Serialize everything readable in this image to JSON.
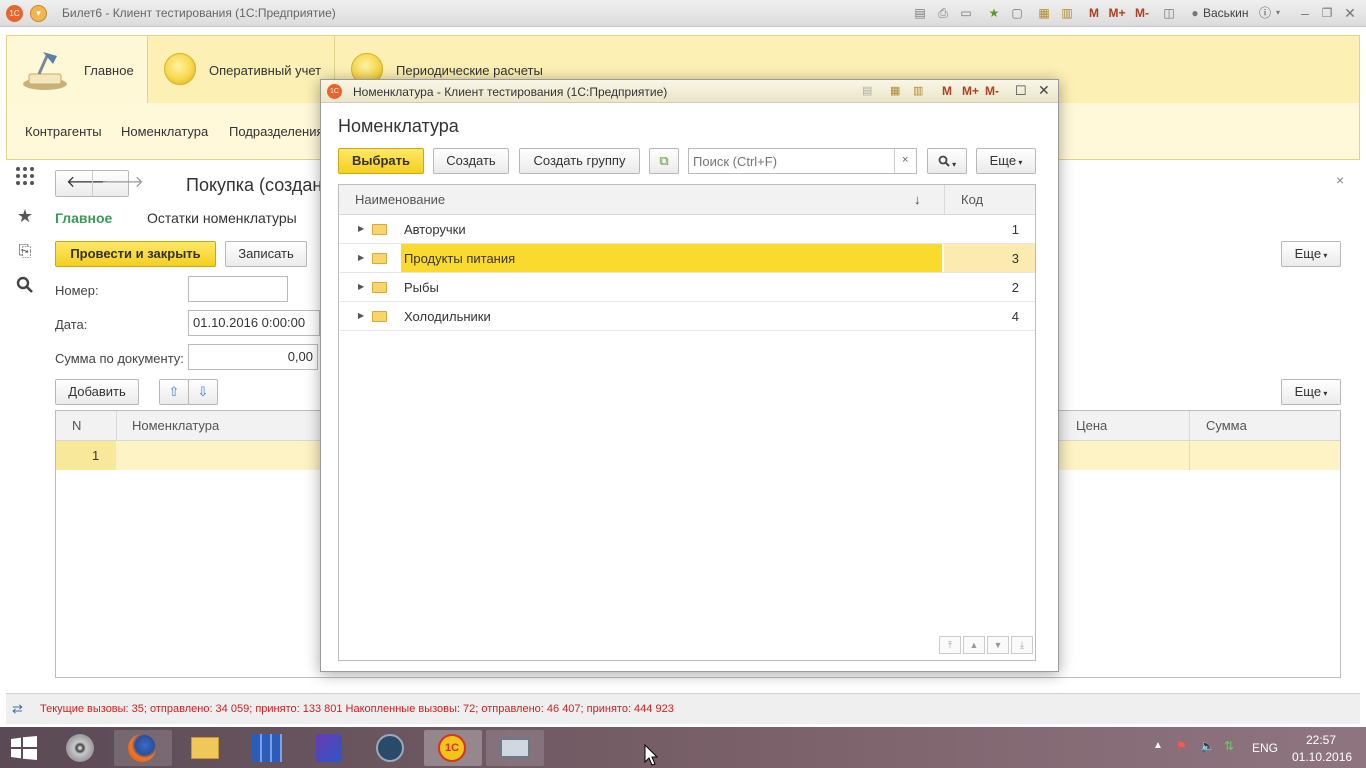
{
  "app": {
    "title": "Билет6  - Клиент тестирования (1С:Предприятие)",
    "user": "Васькин",
    "m_label": "M",
    "mplus_label": "M+",
    "mminus_label": "M-"
  },
  "sections": [
    {
      "label": "Главное"
    },
    {
      "label": "Оперативный учет"
    },
    {
      "label": "Периодические расчеты"
    }
  ],
  "nav": {
    "items": [
      {
        "label": "Контрагенты"
      },
      {
        "label": "Номенклатура"
      },
      {
        "label": "Подразделения"
      }
    ]
  },
  "form": {
    "title": "Покупка (создан",
    "tab_main": "Главное",
    "tab_remains": "Остатки номенклатуры",
    "post_close_label": "Провести и закрыть",
    "save_label": "Записать",
    "more_label": "Еще",
    "number_label": "Номер:",
    "number_value": "",
    "date_label": "Дата:",
    "date_value": "01.10.2016  0:00:00",
    "sum_label": "Сумма по документу:",
    "sum_value": "0,00",
    "add_label": "Добавить",
    "table": {
      "col_n": "N",
      "col_item": "Номенклатура",
      "col_price": "Цена",
      "col_sum": "Сумма",
      "rows": [
        {
          "n": "1"
        }
      ]
    }
  },
  "dialog": {
    "window_title": "Номенклатура  - Клиент тестирования (1С:Предприятие)",
    "heading": "Номенклатура",
    "select_label": "Выбрать",
    "create_label": "Создать",
    "create_group_label": "Создать группу",
    "search_placeholder": "Поиск (Ctrl+F)",
    "more_label": "Еще",
    "col_name": "Наименование",
    "col_code": "Код",
    "rows": [
      {
        "name": "Авторучки",
        "code": "1"
      },
      {
        "name": "Продукты питания",
        "code": "3"
      },
      {
        "name": "Рыбы",
        "code": "2"
      },
      {
        "name": "Холодильники",
        "code": "4"
      }
    ],
    "selected_row": 1
  },
  "status": {
    "text": "Текущие вызовы: 35; отправлено: 34 059; принято: 133 801   Накопленные вызовы: 72; отправлено: 46 407; принято: 444 923"
  },
  "taskbar": {
    "lang": "ENG",
    "time": "22:57",
    "date": "01.10.2016"
  },
  "colors": {
    "accent_yellow": "#f5cf1f",
    "selection": "#fbda2e",
    "section_bg": "#fcf0b4",
    "status_red": "#d02020",
    "link_green": "#3a9a5a"
  }
}
